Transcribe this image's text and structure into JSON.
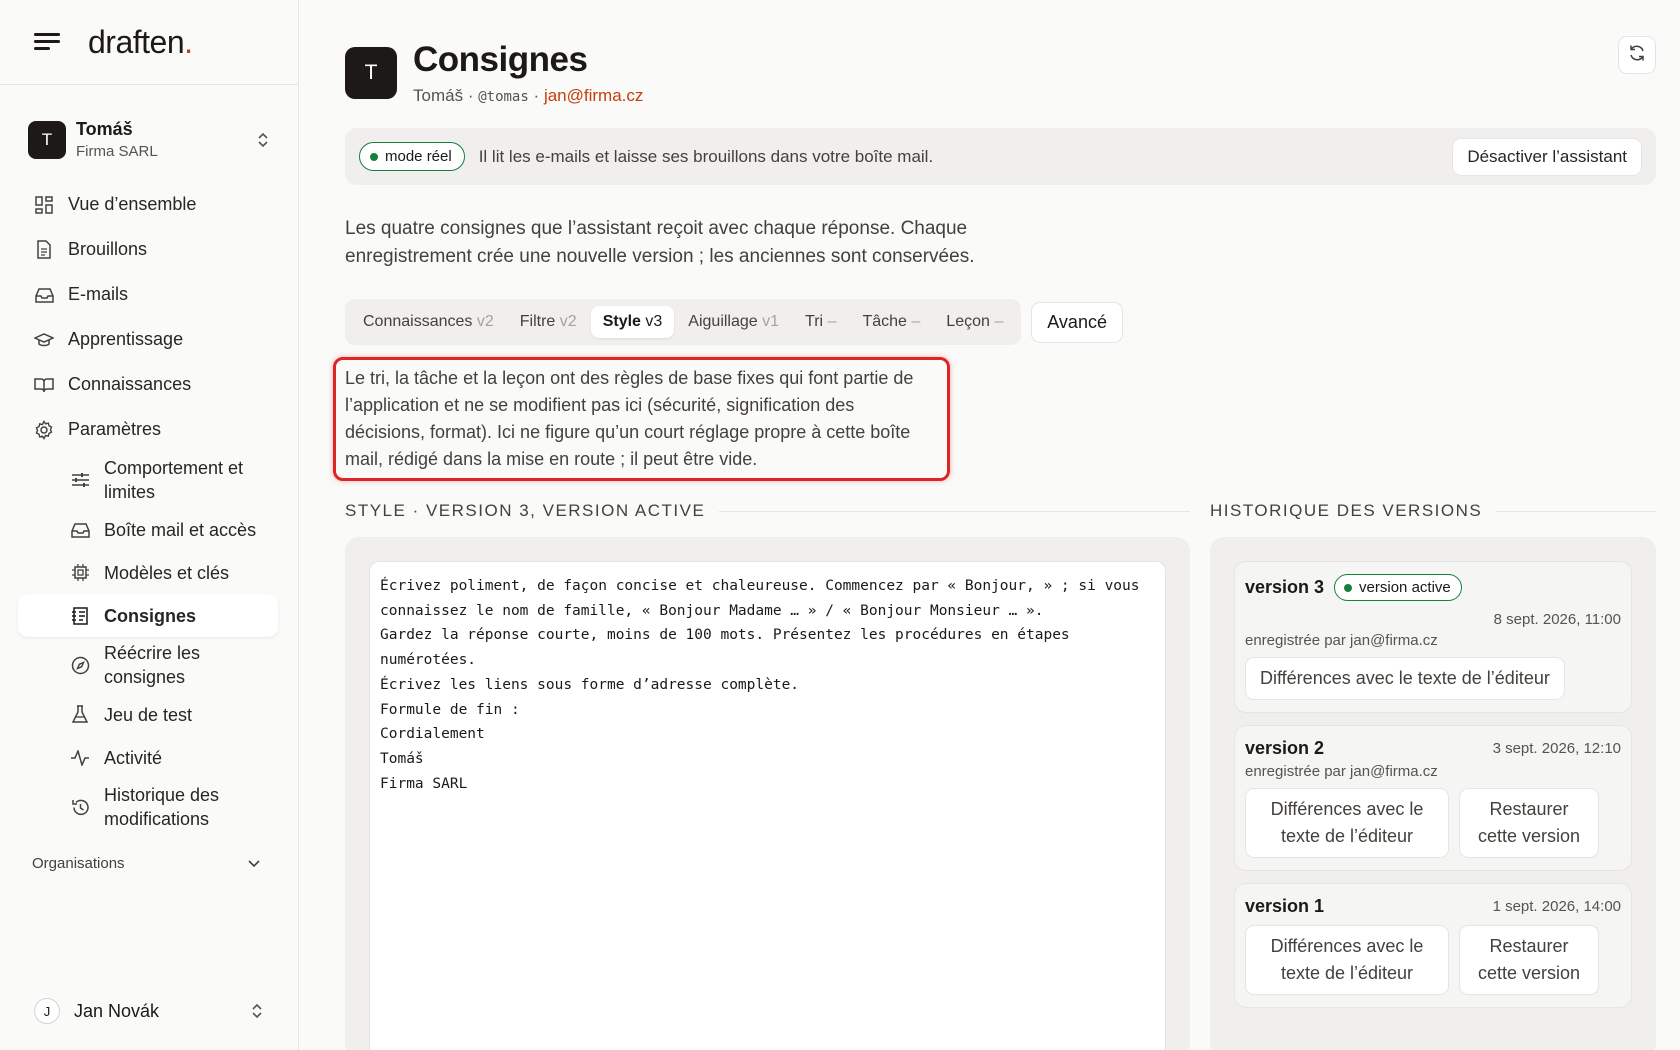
{
  "brand": {
    "name": "draften",
    "dot": "."
  },
  "account": {
    "initial": "T",
    "name": "Tomáš",
    "org": "Firma SARL"
  },
  "nav": {
    "overview": "Vue d’ensemble",
    "drafts": "Brouillons",
    "emails": "E-mails",
    "learning": "Apprentissage",
    "knowledge": "Connaissances",
    "settings": "Paramètres"
  },
  "subnav": {
    "behaviour": "Comportement et limites",
    "mailbox": "Boîte mail et accès",
    "models": "Modèles et clés",
    "instructions": "Consignes",
    "rewrite": "Réécrire les consignes",
    "testset": "Jeu de test",
    "activity": "Activité",
    "history": "Historique des modifications"
  },
  "organisations": "Organisations",
  "user": {
    "initial": "J",
    "name": "Jan Novák"
  },
  "page": {
    "initial": "T",
    "title": "Consignes",
    "name": "Tomáš",
    "sep": "·",
    "handle": "@tomas",
    "email": "jan@firma.cz"
  },
  "status": {
    "pill": "mode réel",
    "text": "Il lit les e-mails et laisse ses brouillons dans votre boîte mail.",
    "disable_btn": "Désactiver l’assistant"
  },
  "intro": "Les quatre consignes que l’assistant reçoit avec chaque réponse. Chaque enregistrement crée une nouvelle version ; les anciennes sont conservées.",
  "tabs": [
    {
      "label": "Connaissances",
      "ver": "v2"
    },
    {
      "label": "Filtre",
      "ver": "v2"
    },
    {
      "label": "Style",
      "ver": "v3"
    },
    {
      "label": "Aiguillage",
      "ver": "v1"
    },
    {
      "label": "Tri",
      "ver": "–"
    },
    {
      "label": "Tâche",
      "ver": "–"
    },
    {
      "label": "Leçon",
      "ver": "–"
    }
  ],
  "advanced": "Avancé",
  "notice": "Le tri, la tâche et la leçon ont des règles de base fixes qui font partie de l’application et ne se modifient pas ici (sécurité, signification des décisions, format). Ici ne figure qu’un court réglage propre à cette boîte mail, rédigé dans la mise en route ; il peut être vide.",
  "editor": {
    "heading": "Style · version 3, version active",
    "content": "Écrivez poliment, de façon concise et chaleureuse. Commencez par « Bonjour, » ; si vous connaissez le nom de famille, « Bonjour Madame … » / « Bonjour Monsieur … ».\nGardez la réponse courte, moins de 100 mots. Présentez les procédures en étapes numérotées.\nÉcrivez les liens sous forme d’adresse complète.\nFormule de fin :\nCordialement\nTomáš\nFirma SARL"
  },
  "history": {
    "heading": "Historique des versions",
    "versions": [
      {
        "name": "version 3",
        "badge": "version active",
        "date": "8 sept. 2026, 11:00",
        "by": "enregistrée par jan@firma.cz",
        "diff": "Différences avec le texte de l’éditeur"
      },
      {
        "name": "version 2",
        "date": "3 sept. 2026, 12:10",
        "by": "enregistrée par jan@firma.cz",
        "diff": "Différences avec le texte de l’éditeur",
        "restore": "Restaurer cette version"
      },
      {
        "name": "version 1",
        "date": "1 sept. 2026, 14:00",
        "diff": "Différences avec le texte de l’éditeur",
        "restore": "Restaurer cette version"
      }
    ]
  },
  "colors": {
    "accent": "#c2410c",
    "active_green": "#15803d",
    "highlight": "#dc2626"
  }
}
